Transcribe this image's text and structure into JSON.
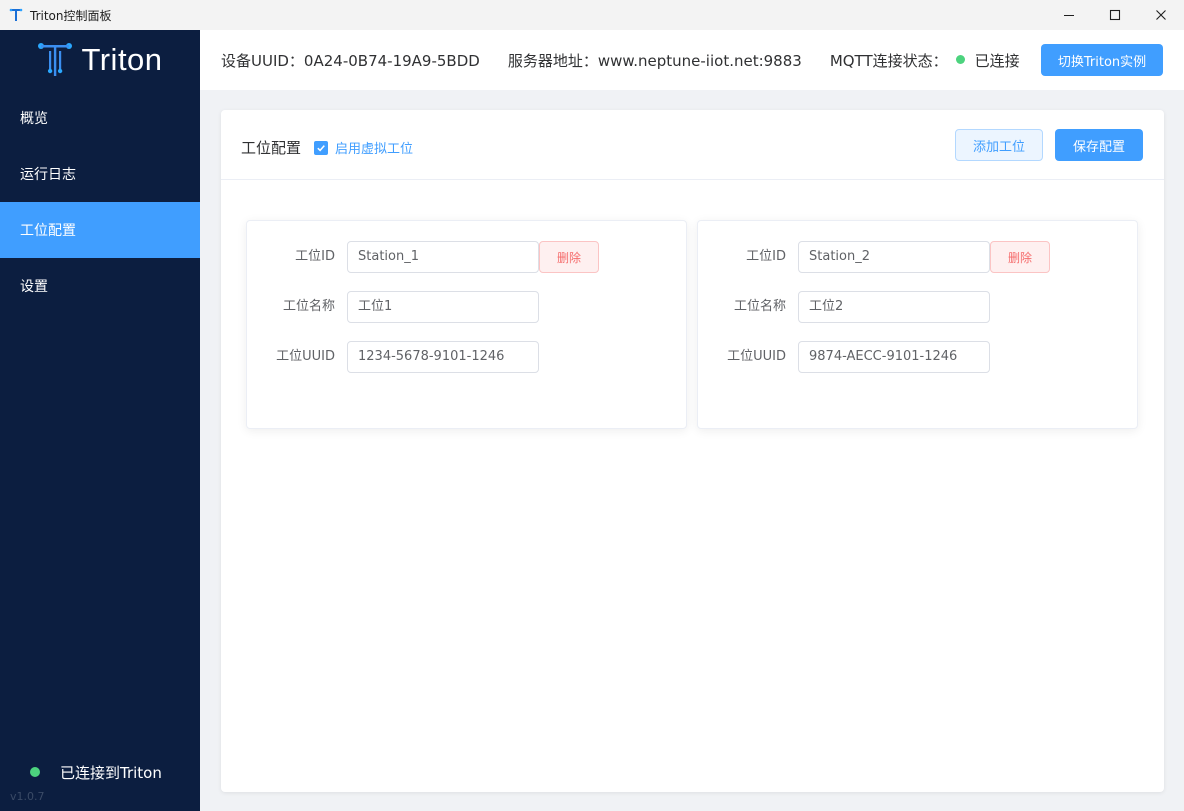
{
  "window": {
    "title": "Triton控制面板"
  },
  "sidebar": {
    "logo": "Triton",
    "items": [
      {
        "label": "概览"
      },
      {
        "label": "运行日志"
      },
      {
        "label": "工位配置",
        "active": true
      },
      {
        "label": "设置"
      }
    ],
    "status_text": "已连接到Triton",
    "version": "v1.0.7"
  },
  "header": {
    "device_uuid": "设备UUID：0A24-0B74-19A9-5BDD",
    "server_address": "服务器地址：www.neptune-iiot.net:9883",
    "mqtt_label": "MQTT连接状态：",
    "mqtt_status": "已连接",
    "switch_button": "切换Triton实例"
  },
  "main": {
    "title": "工位配置",
    "virtual_checkbox_label": "启用虚拟工位",
    "virtual_checked": true,
    "add_button": "添加工位",
    "save_button": "保存配置",
    "stations": [
      {
        "id_label": "工位ID",
        "id_value": "Station_1",
        "name_label": "工位名称",
        "name_value": "工位1",
        "uuid_label": "工位UUID",
        "uuid_value": "1234-5678-9101-1246",
        "delete_label": "删除"
      },
      {
        "id_label": "工位ID",
        "id_value": "Station_2",
        "name_label": "工位名称",
        "name_value": "工位2",
        "uuid_label": "工位UUID",
        "uuid_value": "9874-AECC-9101-1246",
        "delete_label": "删除"
      }
    ]
  },
  "colors": {
    "sidebar_bg": "#0c1e40",
    "accent": "#409eff",
    "connected": "#4cd37e",
    "danger": "#f56c6c"
  }
}
